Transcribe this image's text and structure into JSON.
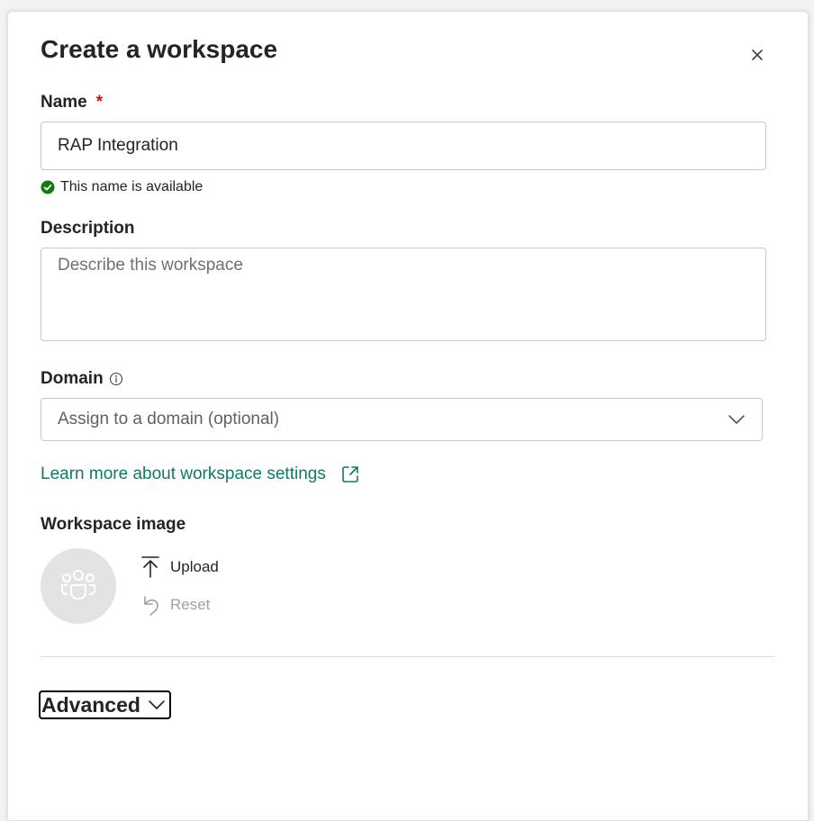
{
  "dialog": {
    "title": "Create a workspace",
    "close_icon": "close-icon"
  },
  "name": {
    "label": "Name",
    "required_marker": "*",
    "value": "RAP Integration",
    "availability": "This name is available",
    "availability_icon": "check-circle-icon"
  },
  "description": {
    "label": "Description",
    "placeholder": "Describe this workspace",
    "value": ""
  },
  "domain": {
    "label": "Domain",
    "info_icon": "info-icon",
    "selected": "Assign to a domain (optional)",
    "dropdown_icon": "chevron-down-icon"
  },
  "learn_more": {
    "label": "Learn more about workspace settings",
    "icon": "external-link-icon"
  },
  "workspace_image": {
    "label": "Workspace image",
    "placeholder_icon": "people-group-icon",
    "upload_label": "Upload",
    "upload_icon": "upload-icon",
    "reset_label": "Reset",
    "reset_icon": "undo-icon"
  },
  "advanced": {
    "label": "Advanced",
    "icon": "chevron-down-icon"
  },
  "colors": {
    "link": "#117865",
    "success": "#107c10",
    "required": "#c50f1f",
    "disabled_text": "#a0a0a0",
    "avatar_bg": "#e3e3e3"
  }
}
